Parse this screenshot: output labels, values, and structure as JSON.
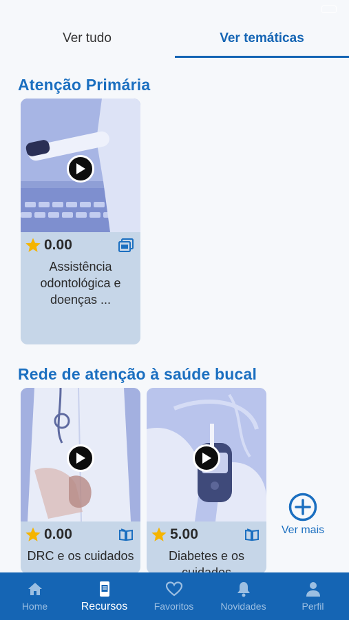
{
  "tabs": {
    "all_label": "Ver tudo",
    "themes_label": "Ver temáticas"
  },
  "sections": [
    {
      "title": "Atenção Primária",
      "cards": [
        {
          "rating": "0.00",
          "title": "Assistência odontológica e doenças ...",
          "type_icon": "pdf-icon"
        }
      ]
    },
    {
      "title": "Rede de atenção à saúde bucal",
      "cards": [
        {
          "rating": "0.00",
          "title": "DRC e os cuidados",
          "type_icon": "book-icon"
        },
        {
          "rating": "5.00",
          "title": "Diabetes e os cuidados",
          "type_icon": "book-icon"
        }
      ],
      "see_more": "Ver mais"
    }
  ],
  "bottom_nav": {
    "home": "Home",
    "resources": "Recursos",
    "favorites": "Favoritos",
    "news": "Novidades",
    "profile": "Perfil"
  },
  "colors": {
    "accent": "#1565b4",
    "section_title": "#1b6fc0",
    "card_bg": "#c6d6e8",
    "star": "#f5b400"
  }
}
